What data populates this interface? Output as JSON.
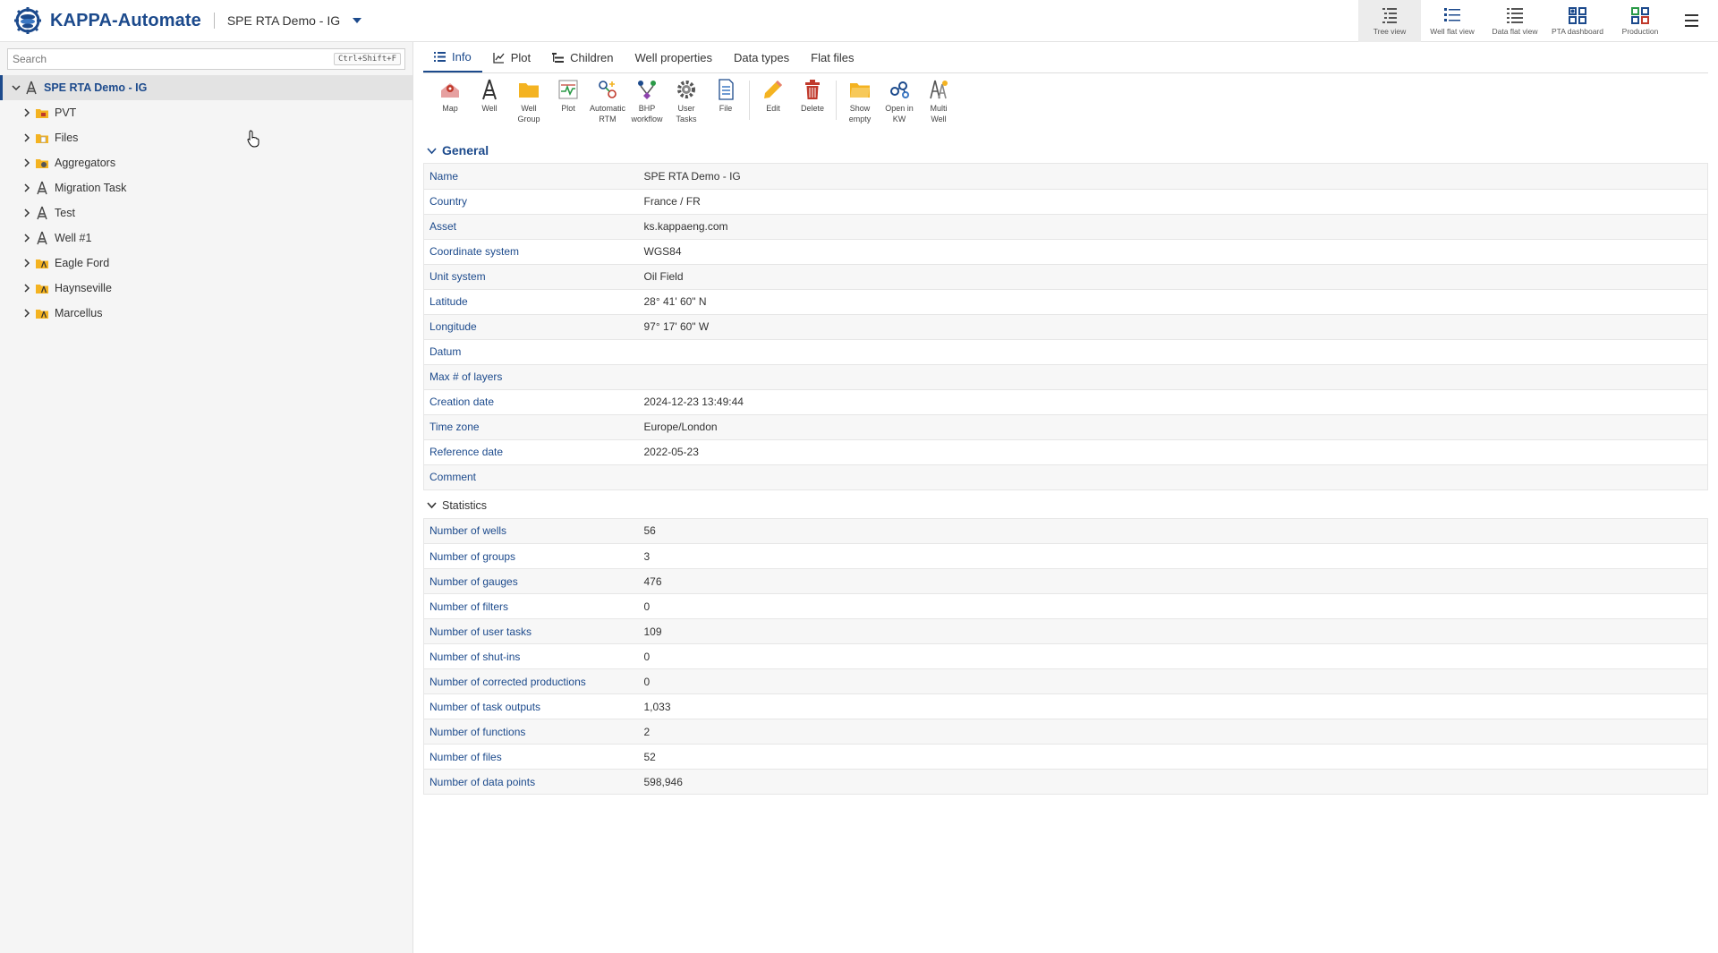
{
  "header": {
    "brand": "KAPPA-Automate",
    "project": "SPE RTA Demo - IG",
    "views": [
      {
        "label": "Tree view",
        "icon": "tree-view-icon",
        "active": true
      },
      {
        "label": "Well flat view",
        "icon": "well-flat-view-icon"
      },
      {
        "label": "Data flat view",
        "icon": "data-flat-view-icon"
      },
      {
        "label": "PTA dashboard",
        "icon": "pta-dashboard-icon"
      },
      {
        "label": "Production",
        "icon": "production-icon"
      }
    ]
  },
  "sidebar": {
    "search_placeholder": "Search",
    "shortcut": "Ctrl+Shift+F",
    "root": "SPE RTA Demo - IG",
    "items": [
      {
        "label": "PVT",
        "icon": "pvt-folder-icon"
      },
      {
        "label": "Files",
        "icon": "files-folder-icon"
      },
      {
        "label": "Aggregators",
        "icon": "aggregators-folder-icon"
      },
      {
        "label": "Migration Task",
        "icon": "well-icon"
      },
      {
        "label": "Test",
        "icon": "well-icon"
      },
      {
        "label": "Well #1",
        "icon": "well-icon"
      },
      {
        "label": "Eagle Ford",
        "icon": "well-group-folder-icon"
      },
      {
        "label": "Haynseville",
        "icon": "well-group-folder-icon"
      },
      {
        "label": "Marcellus",
        "icon": "well-group-folder-icon"
      }
    ]
  },
  "tabs": [
    {
      "label": "Info",
      "active": true
    },
    {
      "label": "Plot"
    },
    {
      "label": "Children"
    },
    {
      "label": "Well properties"
    },
    {
      "label": "Data types"
    },
    {
      "label": "Flat files"
    }
  ],
  "toolbar": {
    "map": "Map",
    "well": "Well",
    "well_group_1": "Well",
    "well_group_2": "Group",
    "plot": "Plot",
    "auto_rtm_1": "Automatic",
    "auto_rtm_2": "RTM",
    "bhp_1": "BHP",
    "bhp_2": "workflow",
    "user_tasks_1": "User",
    "user_tasks_2": "Tasks",
    "file": "File",
    "edit": "Edit",
    "delete": "Delete",
    "show_empty_1": "Show",
    "show_empty_2": "empty",
    "open_kw_1": "Open in",
    "open_kw_2": "KW",
    "multi_well_1": "Multi",
    "multi_well_2": "Well"
  },
  "general": {
    "title": "General",
    "rows": [
      {
        "key": "Name",
        "value": "SPE RTA Demo - IG"
      },
      {
        "key": "Country",
        "value": "France / FR"
      },
      {
        "key": "Asset",
        "value": "ks.kappaeng.com"
      },
      {
        "key": "Coordinate system",
        "value": "WGS84"
      },
      {
        "key": "Unit system",
        "value": "Oil Field"
      },
      {
        "key": "Latitude",
        "value": "28° 41' 60\" N"
      },
      {
        "key": "Longitude",
        "value": "97° 17' 60\" W"
      },
      {
        "key": "Datum",
        "value": ""
      },
      {
        "key": "Max # of layers",
        "value": ""
      },
      {
        "key": "Creation date",
        "value": "2024-12-23 13:49:44"
      },
      {
        "key": "Time zone",
        "value": "Europe/London"
      },
      {
        "key": "Reference date",
        "value": "2022-05-23"
      },
      {
        "key": "Comment",
        "value": ""
      }
    ]
  },
  "statistics": {
    "title": "Statistics",
    "rows": [
      {
        "key": "Number of wells",
        "value": "56"
      },
      {
        "key": "Number of groups",
        "value": "3"
      },
      {
        "key": "Number of gauges",
        "value": "476"
      },
      {
        "key": "Number of filters",
        "value": "0"
      },
      {
        "key": "Number of user tasks",
        "value": "109"
      },
      {
        "key": "Number of shut-ins",
        "value": "0"
      },
      {
        "key": "Number of corrected productions",
        "value": "0"
      },
      {
        "key": "Number of task outputs",
        "value": "1,033"
      },
      {
        "key": "Number of functions",
        "value": "2"
      },
      {
        "key": "Number of files",
        "value": "52"
      },
      {
        "key": "Number of data points",
        "value": "598,946"
      }
    ]
  },
  "colors": {
    "accent": "#1c4a8c",
    "folder": "#f4b321",
    "danger": "#c0392b"
  }
}
